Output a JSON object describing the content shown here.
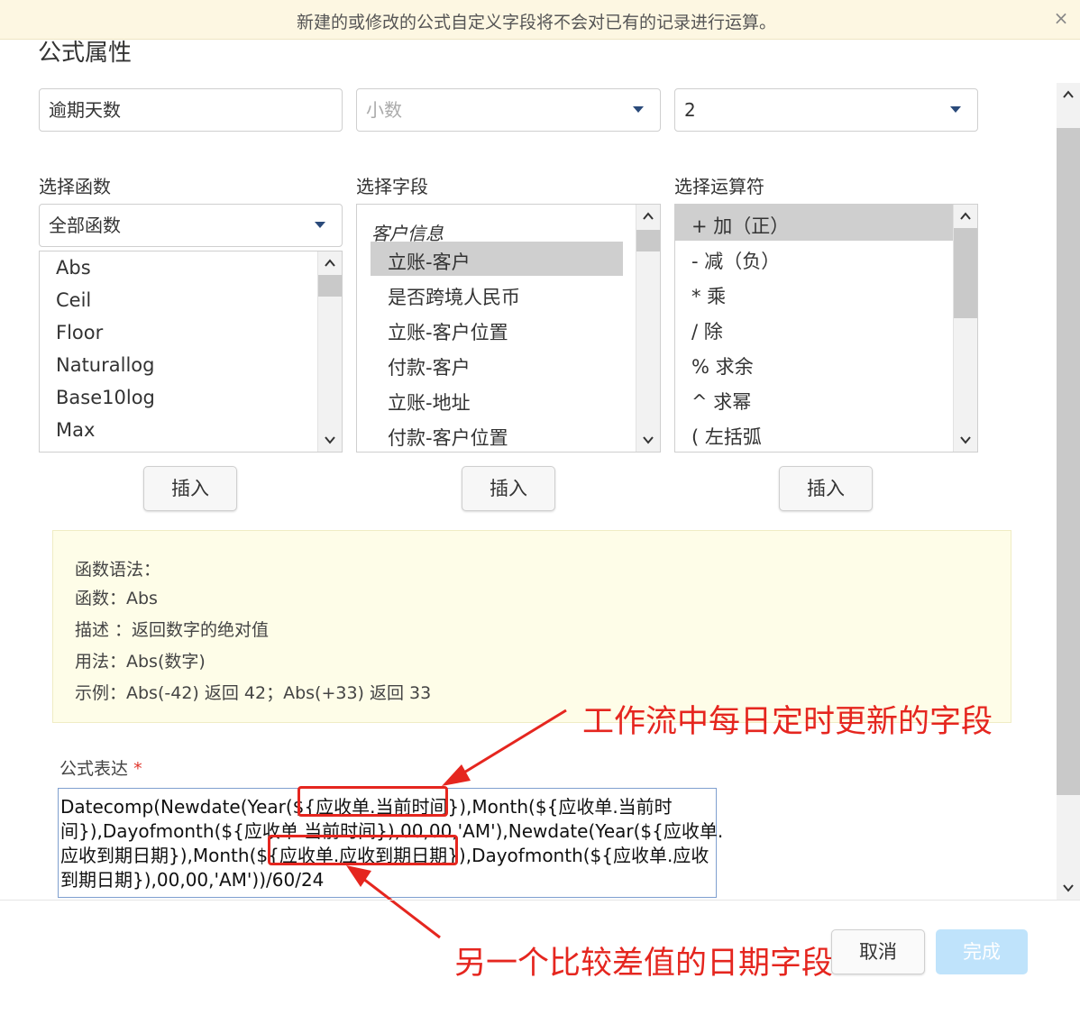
{
  "banner": {
    "message": "新建的或修改的公式自定义字段将不会对已有的记录进行运算。",
    "close_symbol": "×"
  },
  "dialog": {
    "title": "公式属性"
  },
  "top_fields": {
    "name_value": "逾期天数",
    "type_placeholder": "小数",
    "decimals_value": "2"
  },
  "functions": {
    "label": "选择函数",
    "dropdown_value": "全部函数",
    "items": [
      "Abs",
      "Ceil",
      "Floor",
      "Naturallog",
      "Base10log",
      "Max"
    ],
    "insert_label": "插入"
  },
  "fields": {
    "label": "选择字段",
    "group": "客户信息",
    "items": [
      "立账-客户",
      "是否跨境人民币",
      "立账-客户位置",
      "付款-客户",
      "立账-地址",
      "付款-客户位置"
    ],
    "selected_index": 0,
    "insert_label": "插入"
  },
  "operators": {
    "label": "选择运算符",
    "items": [
      "+ 加（正）",
      "- 减（负）",
      "* 乘",
      "/ 除",
      "% 求余",
      "^ 求幂",
      "( 左括弧"
    ],
    "selected_index": 0,
    "insert_label": "插入"
  },
  "help": {
    "heading": "函数语法：",
    "function_line": "函数：Abs",
    "description_line": "描述 ：返回数字的绝对值",
    "usage_line": "用法：Abs(数字)",
    "example_line": "示例：Abs(-42) 返回 42；Abs(+33) 返回 33"
  },
  "formula": {
    "label": "公式表达",
    "required_mark": "*",
    "lines": [
      "Datecomp(Newdate(Year(${应收单.当前时间}),Month(${应收单.当前时",
      "间}),Dayofmonth(${应收单.当前时间}),00,00,'AM'),Newdate(Year(${应收单.",
      "应收到期日期}),Month(${应收单.应收到期日期}),Dayofmonth(${应收单.应收",
      "到期日期}),00,00,'AM'))/60/24"
    ]
  },
  "annotations": {
    "top": "工作流中每日定时更新的字段",
    "bottom": "另一个比较差值的日期字段",
    "color": "#e5261f"
  },
  "footer": {
    "cancel_label": "取消",
    "done_label": "完成"
  }
}
